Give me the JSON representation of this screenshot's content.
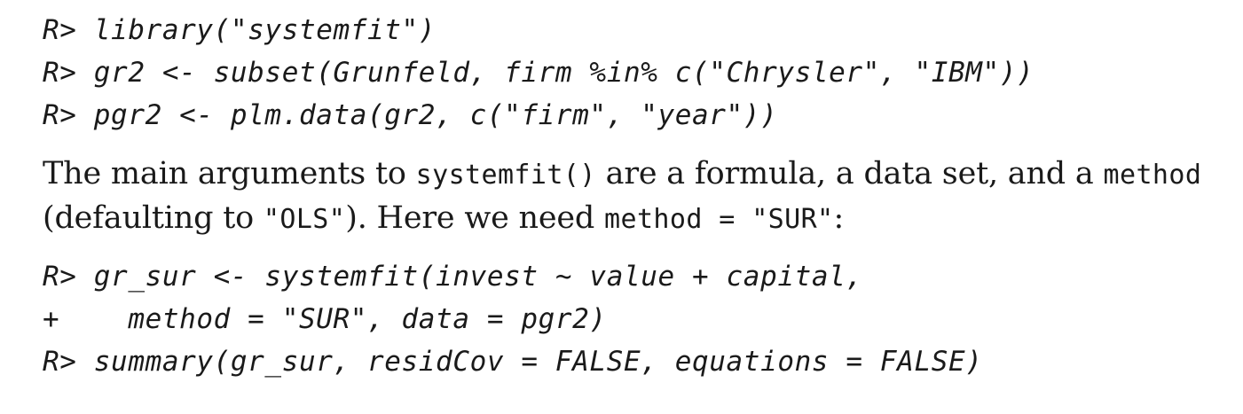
{
  "code_block_1": {
    "lines": [
      "R> library(\"systemfit\")",
      "R> gr2 <- subset(Grunfeld, firm %in% c(\"Chrysler\", \"IBM\"))",
      "R> pgr2 <- plm.data(gr2, c(\"firm\", \"year\"))"
    ]
  },
  "paragraph": {
    "line1": {
      "t1": "The main arguments to ",
      "c1": "systemfit()",
      "t2": " are a formula, a data set, and a ",
      "c2": "method"
    },
    "line2": {
      "t1": "(defaulting to ",
      "c1": "\"OLS\"",
      "t2": "). Here we need ",
      "c2": "method = \"SUR\"",
      "t3": ":"
    }
  },
  "code_block_2": {
    "lines": [
      "R> gr_sur <- systemfit(invest ~ value + capital,",
      "+    method = \"SUR\", data = pgr2)",
      "R> summary(gr_sur, residCov = FALSE, equations = FALSE)"
    ]
  }
}
